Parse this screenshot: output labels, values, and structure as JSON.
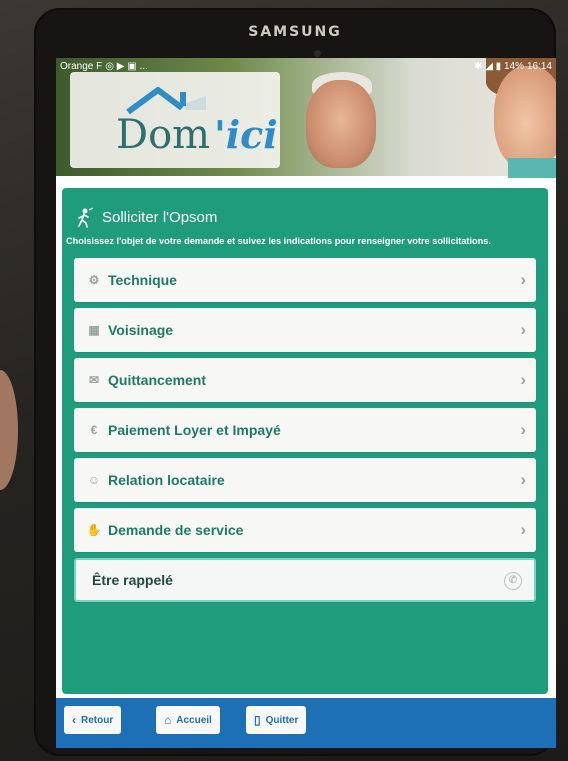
{
  "device": {
    "brand": "SAMSUNG"
  },
  "status_bar": {
    "carrier": "Orange F",
    "indicators_left": "◎ ▶ ▣ ...",
    "indicators_right": "✱ ◢ ▮ 14%",
    "time": "16:14"
  },
  "app": {
    "logo": {
      "main": "Dom",
      "accent": "'ici"
    }
  },
  "panel": {
    "icon": "walker-icon",
    "title": "Solliciter l'Opsom",
    "subtitle": "Choisissez l'objet de votre demande et suivez les indications pour renseigner votre sollicitations."
  },
  "items": [
    {
      "label": "Technique",
      "icon": "tools-icon"
    },
    {
      "label": "Voisinage",
      "icon": "building-icon"
    },
    {
      "label": "Quittancement",
      "icon": "envelope-icon"
    },
    {
      "label": "Paiement Loyer et Impayé",
      "icon": "euro-icon"
    },
    {
      "label": "Relation locataire",
      "icon": "people-icon"
    },
    {
      "label": "Demande de service",
      "icon": "handshake-icon"
    }
  ],
  "callback": {
    "label": "Être rappelé",
    "icon": "phone-icon"
  },
  "bottom_bar": {
    "back": "Retour",
    "home": "Accueil",
    "quit": "Quitter"
  },
  "colors": {
    "panel_green": "#1f9c7c",
    "item_text": "#1f7a64",
    "bottom_blue": "#1d6fb6",
    "logo_teal": "#2d6f6c",
    "logo_blue": "#2f8cc7"
  }
}
